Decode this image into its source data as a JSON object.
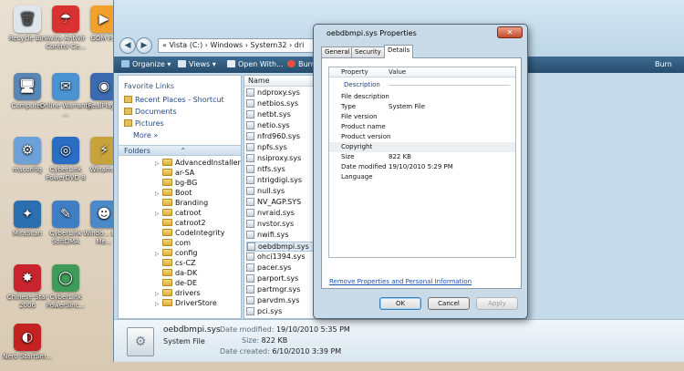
{
  "desktop": {
    "icons": [
      {
        "label": "Recycle Bin",
        "glyph": "🗑",
        "color": "#dfe6ec"
      },
      {
        "label": "Avira AntiVir Control Ce...",
        "glyph": "☂",
        "color": "#d93232"
      },
      {
        "label": "GOM P...",
        "glyph": "▶",
        "color": "#f2a12c"
      },
      {
        "label": "Computer",
        "glyph": "🖥",
        "color": "#5a86b5"
      },
      {
        "label": "Online Warranty ...",
        "glyph": "✉",
        "color": "#4a92d0"
      },
      {
        "label": "RealPlay...",
        "glyph": "◉",
        "color": "#3a6bb0"
      },
      {
        "label": "msconfig",
        "glyph": "⚙",
        "color": "#6ea1d8"
      },
      {
        "label": "CyberLink PowerDVD 8",
        "glyph": "◎",
        "color": "#2a6dc5"
      },
      {
        "label": "Winam...",
        "glyph": "⚡",
        "color": "#c8a23a"
      },
      {
        "label": "MiraScan",
        "glyph": "✦",
        "color": "#2b6fb1"
      },
      {
        "label": "CyberLink SoftDMA",
        "glyph": "✎",
        "color": "#3f7ec2"
      },
      {
        "label": "Windo... Live Me...",
        "glyph": "☻",
        "color": "#4c89c9"
      },
      {
        "label": "Chinese Star 2006",
        "glyph": "✸",
        "color": "#c9242d"
      },
      {
        "label": "CyberLink PowerSinc...",
        "glyph": "◯",
        "color": "#3f9b5c"
      },
      {
        "label": "Nero StartSm...",
        "glyph": "◐",
        "color": "#c42121"
      }
    ]
  },
  "explorer": {
    "address_path": "« Vista (C:) › Windows › System32 › dri",
    "toolbar": {
      "organize": "Organize ▾",
      "views": "Views ▾",
      "open_with": "Open With...",
      "burn": "Burn",
      "burn_right": "Burn"
    },
    "favorite_links_header": "Favorite Links",
    "favorite_links": [
      "Recent Places - Shortcut",
      "Documents",
      "Pictures",
      "More »"
    ],
    "folders_header": "Folders",
    "folders": [
      "AdvancedInstallers",
      "ar-SA",
      "bg-BG",
      "Boot",
      "Branding",
      "catroot",
      "catroot2",
      "CodeIntegrity",
      "com",
      "config",
      "cs-CZ",
      "da-DK",
      "de-DE",
      "drivers",
      "DriverStore"
    ],
    "column_name": "Name",
    "files": [
      "ndproxy.sys",
      "netbios.sys",
      "netbt.sys",
      "netio.sys",
      "nfrd960.sys",
      "npfs.sys",
      "nsiproxy.sys",
      "ntfs.sys",
      "ntrigdigi.sys",
      "null.sys",
      "NV_AGP.SYS",
      "nvraid.sys",
      "nvstor.sys",
      "nwifi.sys",
      "oebdbmpi.sys",
      "ohci1394.sys",
      "pacer.sys",
      "parport.sys",
      "partmgr.sys",
      "parvdm.sys",
      "pci.sys"
    ],
    "selected_file": "oebdbmpi.sys",
    "details": {
      "file_name": "oebdbmpi.sys",
      "file_type": "System File",
      "modified_label": "Date modified:",
      "modified_value": "19/10/2010 5:35 PM",
      "size_label": "Size:",
      "size_value": "822 KB",
      "created_label": "Date created:",
      "created_value": "6/10/2010 3:39 PM"
    }
  },
  "properties": {
    "title": "oebdbmpi.sys Properties",
    "close": "✕",
    "tabs": [
      "General",
      "Security",
      "Details"
    ],
    "active_tab": "Details",
    "col_property": "Property",
    "col_value": "Value",
    "section": "Description",
    "rows": [
      {
        "property": "File description",
        "value": ""
      },
      {
        "property": "Type",
        "value": "System File"
      },
      {
        "property": "File version",
        "value": ""
      },
      {
        "property": "Product name",
        "value": ""
      },
      {
        "property": "Product version",
        "value": ""
      },
      {
        "property": "Copyright",
        "value": ""
      },
      {
        "property": "Size",
        "value": "822 KB"
      },
      {
        "property": "Date modified",
        "value": "19/10/2010 5:29 PM"
      },
      {
        "property": "Language",
        "value": ""
      }
    ],
    "remove_link": "Remove Properties and Personal Information",
    "buttons": {
      "ok": "OK",
      "cancel": "Cancel",
      "apply": "Apply"
    }
  }
}
